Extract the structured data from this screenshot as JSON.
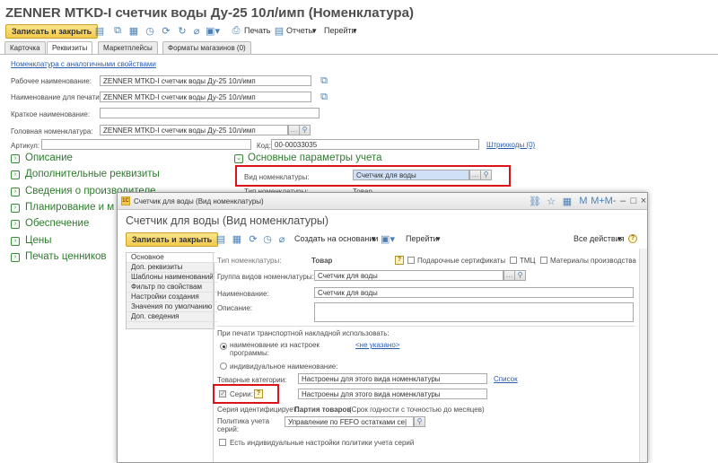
{
  "window": {
    "title": "ZENNER MTKD-I  счетчик воды Ду-25 10л/имп (Номенклатура)"
  },
  "toolbar": {
    "save_close_label": "Записать и закрыть",
    "print_label": "Печать",
    "reports_label": "Отчеты",
    "goto_label": "Перейти"
  },
  "tabs": [
    {
      "label": "Карточка"
    },
    {
      "label": "Реквизиты"
    },
    {
      "label": "Маркетплейсы"
    },
    {
      "label": "Форматы магазинов (0)"
    }
  ],
  "form": {
    "similar_link": "Номенклатура с аналогичными свойствами",
    "work_name_label": "Рабочее наименование:",
    "work_name_value": "ZENNER MTKD-I  счетчик воды Ду-25 10л/имп",
    "print_name_label": "Наименование для печати:",
    "print_name_value": "ZENNER MTKD-I  счетчик воды Ду-25 10л/имп",
    "short_name_label": "Краткое наименование:",
    "short_name_value": "",
    "head_label": "Головная номенклатура:",
    "head_value": "ZENNER MTKD-I  счетчик воды Ду-25 10л/имп",
    "article_label": "Артикул:",
    "article_value": "",
    "code_label": "Код:",
    "code_value": "00-00033035",
    "barcodes_link": "Штрихкоды (0)"
  },
  "sections_left": [
    {
      "label": "Описание"
    },
    {
      "label": "Дополнительные реквизиты"
    },
    {
      "label": "Сведения о производителе"
    },
    {
      "label": "Планирование и м"
    },
    {
      "label": "Обеспечение"
    },
    {
      "label": "Цены"
    },
    {
      "label": "Печать ценников"
    }
  ],
  "sections_right": {
    "main_params": "Основные параметры учета",
    "kind_label": "Вид номенклатуры:",
    "kind_value": "Счетчик для воды",
    "type_label": "Тип номенклатуры:",
    "type_value": "Товар"
  },
  "dialog": {
    "window_title": "Счетчик для воды (Вид номенклатуры)",
    "title": "Счетчик для воды (Вид номенклатуры)",
    "save_close_label": "Записать и закрыть",
    "create_based_label": "Создать на основании",
    "goto_label": "Перейти",
    "all_actions_label": "Все действия",
    "sidebar": [
      {
        "label": "Основное"
      },
      {
        "label": "Доп. реквизиты"
      },
      {
        "label": "Шаблоны наименований"
      },
      {
        "label": "Фильтр по свойствам"
      },
      {
        "label": "Настройки создания"
      },
      {
        "label": "Значения по умолчанию"
      },
      {
        "label": "Доп. сведения"
      }
    ],
    "type_label": "Тип номенклатуры:",
    "type_value": "Товар",
    "gift_cert_label": "Подарочные сертификаты",
    "tmc_label": "ТМЦ",
    "production_materials_label": "Материалы производства",
    "group_label": "Группа видов номенклатуры:",
    "group_value": "Счетчик для воды",
    "name_label": "Наименование:",
    "name_value": "Счетчик для воды",
    "description_label": "Описание:",
    "description_value": "",
    "transport_label": "При печати транспортной накладной использовать:",
    "radio_settings_label": "наименование из настроек программы:",
    "not_specified": "<не указано>",
    "radio_individual_label": "индивидуальное наименование:",
    "product_categories_label": "Товарные категории:",
    "product_categories_value": "Настроены для этого вида номенклатуры",
    "list_link": "Список",
    "series_label": "Серии:",
    "series_value": "Настроены для этого вида номенклатуры",
    "series_identifies_label": "Серия идентифицирует:",
    "series_identifies_value": "Партия товаров",
    "series_identifies_note": "(Срок годности с точностью до месяцев)",
    "policy_label": "Политика учета серий:",
    "policy_value": "Управление по FEFO остатками се|",
    "individual_policy_label": "Есть индивидуальные настройки политики учета серий"
  },
  "colors": {
    "accent_yellow": "#f2c94c",
    "section_green": "#2f7a2f",
    "link_blue": "#2a5db0",
    "highlight_red": "#d9141b"
  }
}
